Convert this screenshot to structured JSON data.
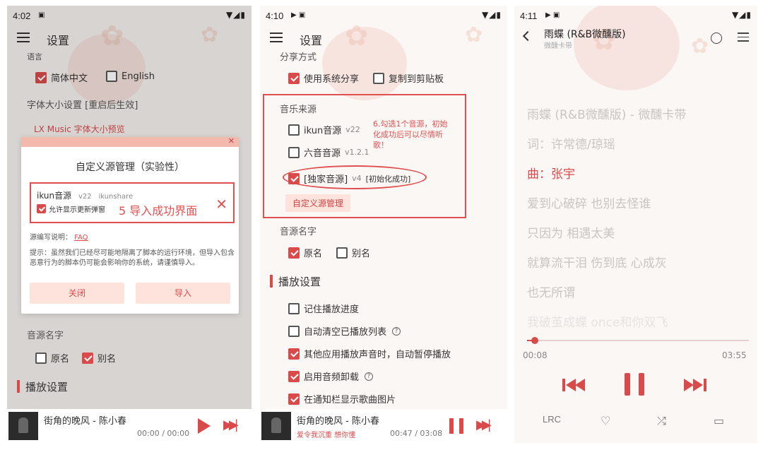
{
  "phone1": {
    "status": {
      "time": "4:02"
    },
    "appbar": {
      "title": "设置"
    },
    "language": {
      "label": "语言",
      "options": [
        {
          "label": "简体中文",
          "checked": true
        },
        {
          "label": "English",
          "checked": false
        }
      ]
    },
    "font_size": {
      "label": "字体大小设置 [重启后生效]",
      "preview": "LX Music 字体大小预览"
    },
    "dialog": {
      "title": "自定义源管理（实验性）",
      "item": {
        "name": "ikun音源",
        "version": "v22",
        "author": "ikunshare",
        "allow_popup_label": "允许显示更新弹窗",
        "allow_popup_checked": true
      },
      "annotation": "5 导入成功界面",
      "delete_icon": "close-icon",
      "doc_label": "源编写说明：",
      "doc_link": "FAQ",
      "warning": "提示：虽然我们已经尽可能地隔离了脚本的运行环境，但导入包含恶意行为的脚本仍可能会影响你的系统，请谨慎导入。",
      "close_button": "关闭",
      "import_button": "导入"
    },
    "source_name": {
      "label": "音源名字",
      "options": [
        {
          "label": "原名",
          "checked": false
        },
        {
          "label": "别名",
          "checked": true
        }
      ]
    },
    "playback_section": "播放设置",
    "mini_player": {
      "song": "街角的晚风 - 陈小春",
      "time": "00:00 / 00:00"
    }
  },
  "phone2": {
    "status": {
      "time": "4:10"
    },
    "appbar": {
      "title": "设置"
    },
    "share": {
      "label": "分享方式",
      "options": [
        {
          "label": "使用系统分享",
          "checked": true
        },
        {
          "label": "复制到剪贴板",
          "checked": false
        }
      ]
    },
    "music_source": {
      "label": "音乐来源",
      "sources": [
        {
          "name": "ikun音源",
          "version": "v22",
          "checked": false
        },
        {
          "name": "六音音源",
          "version": "v1.2.1",
          "checked": false
        },
        {
          "name": "[独家音源]",
          "version": "v4",
          "status": "[初始化成功]",
          "checked": true
        }
      ],
      "annotation": "6.勾选1个音源，初始化成功后可以尽情听歌！",
      "manage_button": "自定义源管理"
    },
    "source_name": {
      "label": "音源名字",
      "options": [
        {
          "label": "原名",
          "checked": true
        },
        {
          "label": "别名",
          "checked": false
        }
      ]
    },
    "playback_section": "播放设置",
    "playback_options": [
      {
        "label": "记住播放进度",
        "checked": false,
        "help": false
      },
      {
        "label": "自动清空已播放列表",
        "checked": false,
        "help": true
      },
      {
        "label": "其他应用播放声音时，自动暂停播放",
        "checked": true,
        "help": false
      },
      {
        "label": "启用音频卸载",
        "checked": true,
        "help": true
      },
      {
        "label": "在通知栏显示歌曲图片",
        "checked": true,
        "help": false
      }
    ],
    "mini_player": {
      "song": "街角的晚风 - 陈小春",
      "lyric": "爱令我沉重 想你懂",
      "time": "00:47 / 03:08"
    }
  },
  "phone3": {
    "status": {
      "time": "4:11"
    },
    "header": {
      "title": "雨蝶 (R&B微醺版)",
      "artist": "微醺卡带"
    },
    "lyrics": [
      {
        "text": "雨蝶 (R&B微醺版) - 微醺卡带",
        "active": false
      },
      {
        "text": "词：许常德/琼瑶",
        "active": false
      },
      {
        "text": "曲：张宇",
        "active": true
      },
      {
        "text": "爱到心破碎 也别去怪谁",
        "active": false
      },
      {
        "text": "只因为 相遇太美",
        "active": false
      },
      {
        "text": "就算流干泪 伤到底 心成灰",
        "active": false
      },
      {
        "text": "也无所谓",
        "active": false
      },
      {
        "text": "我破茧成蝶 once和你双飞",
        "active": false
      }
    ],
    "progress": {
      "current": "00:08",
      "total": "03:55",
      "fraction": 0.035
    },
    "bottom_bar": {
      "lyric_label": "LRC"
    }
  },
  "colors": {
    "accent": "#d94b4b",
    "annotation": "#e05050"
  }
}
